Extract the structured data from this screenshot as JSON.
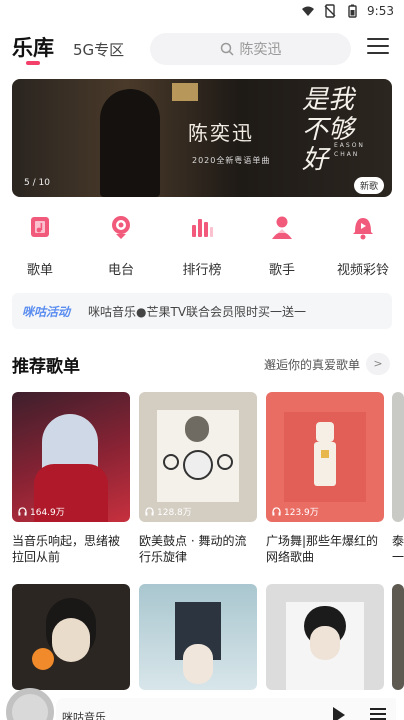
{
  "status_bar": {
    "time": "9:53"
  },
  "header": {
    "tab_main": "乐库",
    "tab_5g": "5G专区",
    "search_placeholder": "陈奕迅"
  },
  "banner": {
    "artist_text": "陈奕迅",
    "subtitle": "2020全新粤语单曲",
    "song_title": "是我不够好",
    "english": "EASON CHAN",
    "page": "5 / 10",
    "badge": "新歌"
  },
  "quick_entries": [
    {
      "label": "歌单",
      "icon": "songlist-icon"
    },
    {
      "label": "电台",
      "icon": "radio-icon"
    },
    {
      "label": "排行榜",
      "icon": "chart-icon"
    },
    {
      "label": "歌手",
      "icon": "singer-icon"
    },
    {
      "label": "视频彩铃",
      "icon": "video-ringtone-icon"
    }
  ],
  "notice": {
    "tag": "咪咕活动",
    "text": "咪咕音乐●芒果TV联合会员限时买一送一"
  },
  "section": {
    "title": "推荐歌单",
    "more": "邂逅你的真爱歌单",
    "more_arrow": ">"
  },
  "playlists": [
    {
      "plays": "164.9万",
      "title": "当音乐响起，思绪被拉回从前"
    },
    {
      "plays": "128.8万",
      "title": "欧美鼓点 · 舞动的流行乐旋律"
    },
    {
      "plays": "123.9万",
      "title": "广场舞|那些年爆红的网络歌曲"
    },
    {
      "plays": "",
      "title": "泰一"
    }
  ],
  "player": {
    "name": "咪咕音乐"
  },
  "colors": {
    "accent": "#f2406a"
  }
}
